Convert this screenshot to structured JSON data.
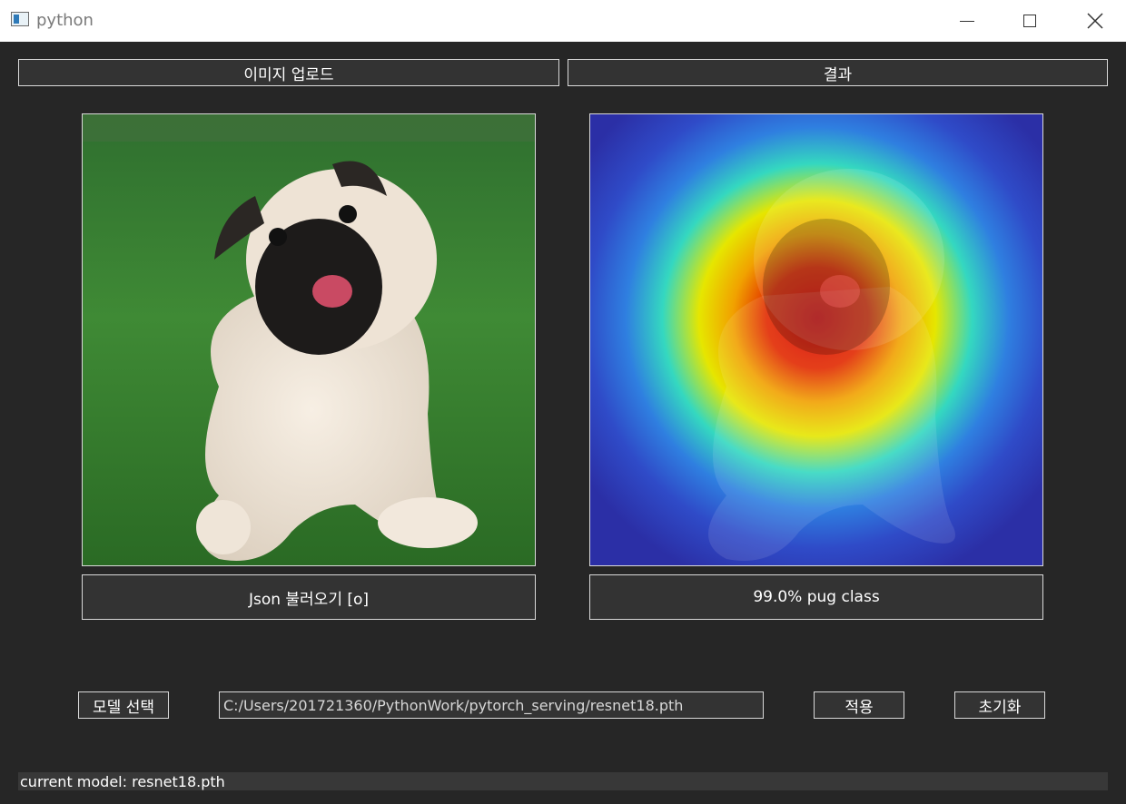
{
  "window": {
    "title": "python"
  },
  "panels": {
    "upload_label": "이미지 업로드",
    "result_label": "결과"
  },
  "actions": {
    "json_load_label": "Json 불러오기 [o]",
    "prediction_label": "99.0% pug class"
  },
  "model": {
    "select_label": "모델 선택",
    "path_value": "C:/Users/201721360/PythonWork/pytorch_serving/resnet18.pth",
    "apply_label": "적용",
    "reset_label": "초기화"
  },
  "status": {
    "text": "current model: resnet18.pth"
  },
  "icons": [
    "app-icon",
    "minimize-icon",
    "maximize-icon",
    "close-icon"
  ],
  "colors": {
    "background": "#262626",
    "titlebar": "#ffffff",
    "border": "#d9d9d9"
  }
}
